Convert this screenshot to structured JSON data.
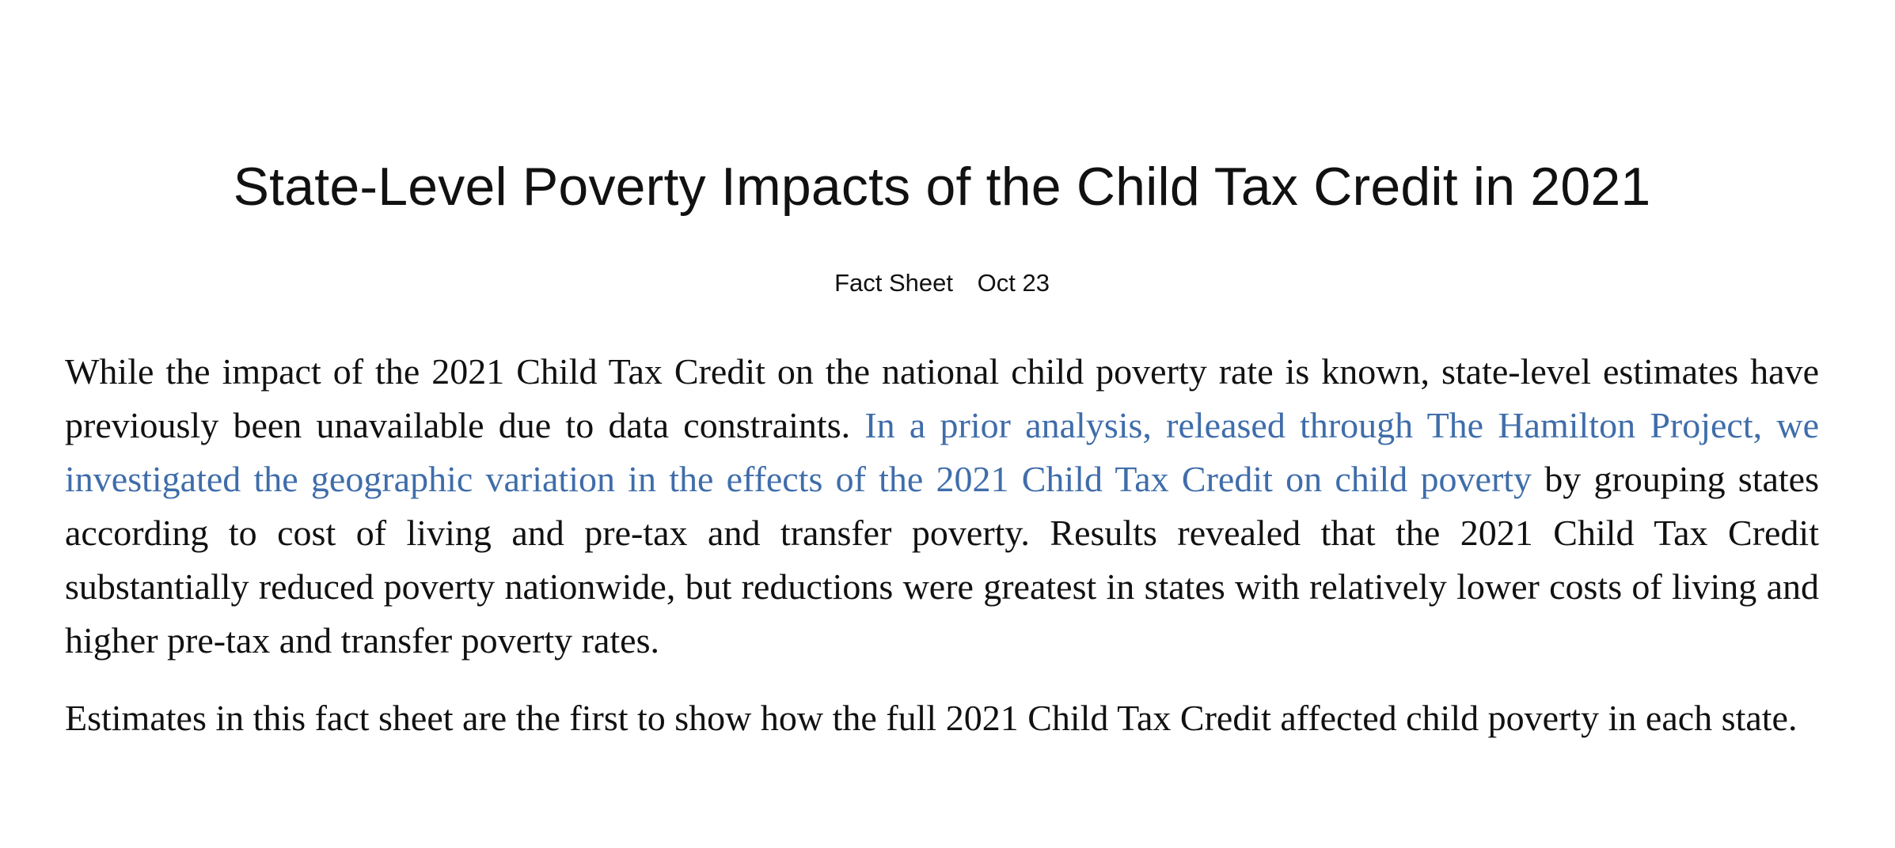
{
  "article": {
    "title": "State-Level Poverty Impacts of the Child Tax Credit in 2021",
    "meta": {
      "type": "Fact Sheet",
      "date": "Oct 23"
    },
    "paragraph1": {
      "before_link": "While the impact of the 2021 Child Tax Credit on the national child poverty rate is known, state-level estimates have previously been unavailable due to data constraints. ",
      "link_text": "In a prior analysis, released through The Hamilton Project, we investigated the geographic variation in the effects of the 2021 Child Tax Credit on child poverty",
      "after_link": " by grouping states according to cost of living and pre-tax and transfer poverty. Results revealed that the 2021 Child Tax Credit substantially reduced poverty nationwide, but reductions were greatest in states with relatively lower costs of living and higher pre-tax and transfer poverty rates."
    },
    "paragraph2": "Estimates in this fact sheet are the first to show how the full 2021 Child Tax Credit affected child poverty in each state.",
    "colors": {
      "text": "#111111",
      "link": "#3f6daa"
    }
  }
}
